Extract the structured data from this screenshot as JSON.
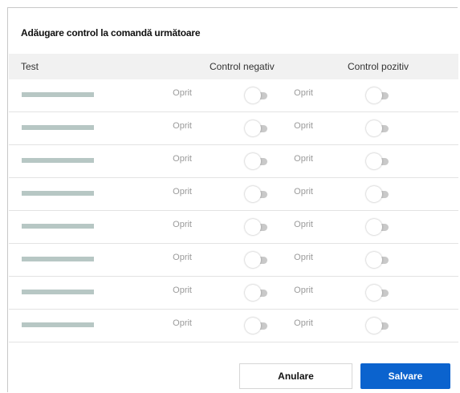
{
  "dialog": {
    "title": "Adăugare control la comandă următoare"
  },
  "table": {
    "columns": [
      "Test",
      "Control negativ",
      "Control pozitiv"
    ],
    "rows": [
      {
        "negative": {
          "label": "Oprit",
          "on": false
        },
        "positive": {
          "label": "Oprit",
          "on": false
        }
      },
      {
        "negative": {
          "label": "Oprit",
          "on": false
        },
        "positive": {
          "label": "Oprit",
          "on": false
        }
      },
      {
        "negative": {
          "label": "Oprit",
          "on": false
        },
        "positive": {
          "label": "Oprit",
          "on": false
        }
      },
      {
        "negative": {
          "label": "Oprit",
          "on": false
        },
        "positive": {
          "label": "Oprit",
          "on": false
        }
      },
      {
        "negative": {
          "label": "Oprit",
          "on": false
        },
        "positive": {
          "label": "Oprit",
          "on": false
        }
      },
      {
        "negative": {
          "label": "Oprit",
          "on": false
        },
        "positive": {
          "label": "Oprit",
          "on": false
        }
      },
      {
        "negative": {
          "label": "Oprit",
          "on": false
        },
        "positive": {
          "label": "Oprit",
          "on": false
        }
      },
      {
        "negative": {
          "label": "Oprit",
          "on": false
        },
        "positive": {
          "label": "Oprit",
          "on": false
        }
      }
    ]
  },
  "footer": {
    "cancel_label": "Anulare",
    "save_label": "Salvare"
  },
  "colors": {
    "accent": "#0b63ce",
    "placeholder_bar": "#b7c7c4",
    "header_bg": "#f1f1f1"
  }
}
